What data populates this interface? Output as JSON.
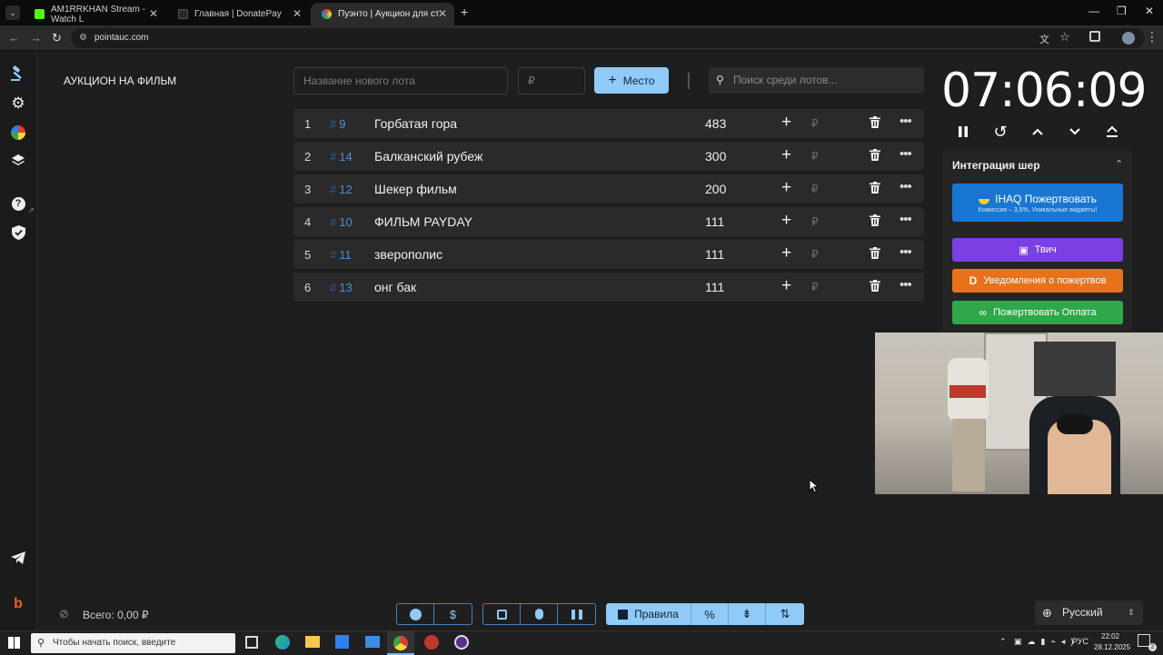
{
  "browser": {
    "tabs": [
      {
        "title": "AM1RRKHAN Stream - Watch L",
        "favicon_color": "#53fc18",
        "active": false
      },
      {
        "title": "Главная | DonatePay",
        "favicon_color": "#2a2a2a",
        "active": false
      },
      {
        "title": "Пуэнто | Аукцион для стримеро",
        "favicon_color": "#e53935",
        "active": true
      }
    ],
    "new_tab": "+",
    "url": "pointauc.com"
  },
  "auction": {
    "title": "АУКЦИОН НА ФИЛЬМ",
    "new_lot_placeholder": "Название нового лота",
    "amount_placeholder": "₽",
    "add_button": "Место",
    "search_placeholder": "Поиск среди лотов...",
    "currency": "₽",
    "lots": [
      {
        "rank": "1",
        "id": "9",
        "name": "Горбатая гора",
        "amount": "483"
      },
      {
        "rank": "2",
        "id": "14",
        "name": "Балканский рубеж",
        "amount": "300"
      },
      {
        "rank": "3",
        "id": "12",
        "name": "Шекер фильм",
        "amount": "200"
      },
      {
        "rank": "4",
        "id": "10",
        "name": "ФИЛЬМ PAYDAY",
        "amount": "111"
      },
      {
        "rank": "5",
        "id": "11",
        "name": "зверополис",
        "amount": "111"
      },
      {
        "rank": "6",
        "id": "13",
        "name": "онг бак",
        "amount": "111"
      }
    ]
  },
  "timer": {
    "value": "07:06:09"
  },
  "integration": {
    "title": "Интеграция шер",
    "buttons": [
      {
        "label": "IHAQ Пожертвовать",
        "sub": "Комиссия – 3,5%. Уникальные виджеты!",
        "color": "#1976d2"
      },
      {
        "label": "Твич",
        "color": "#7b3fe4"
      },
      {
        "label": "Уведомления о пожертвов",
        "color": "#e8711a"
      },
      {
        "label": "Пожертвовать Оплата",
        "color": "#2ea84a"
      }
    ]
  },
  "footer": {
    "total": "Всего: 0,00 ₽",
    "rules_label": "Правила",
    "language": "Русский"
  },
  "taskbar": {
    "search_placeholder": "Чтобы начать поиск, введите",
    "lang": "РУС",
    "time": "22:02",
    "date": "28.12.2025",
    "notifications": "2"
  }
}
